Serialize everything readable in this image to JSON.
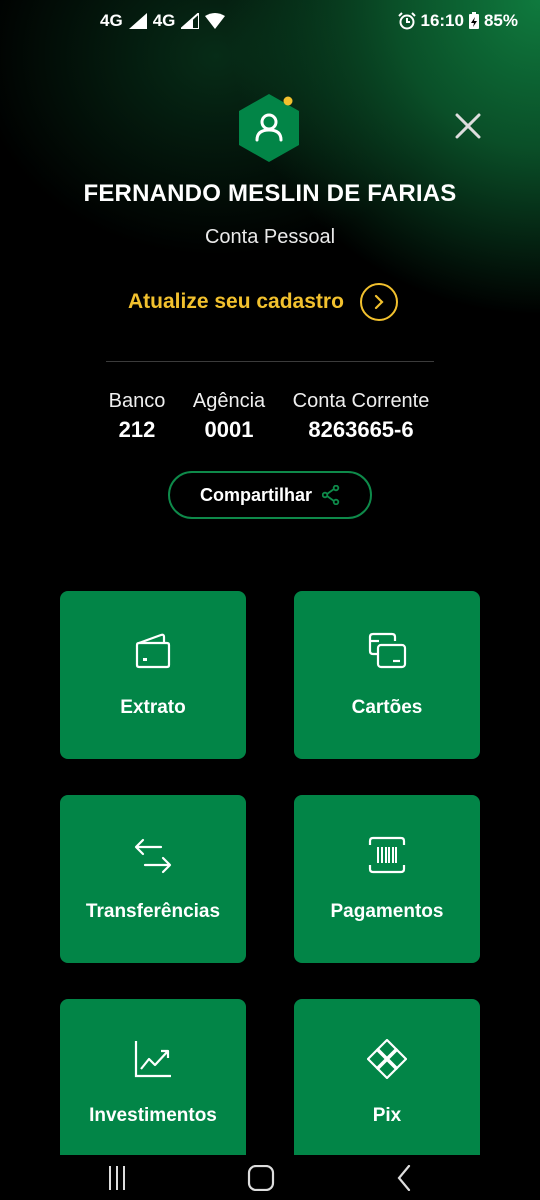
{
  "status_bar": {
    "network1": "4G",
    "network2": "4G",
    "time": "16:10",
    "battery": "85%"
  },
  "profile": {
    "name": "FERNANDO MESLIN DE FARIAS",
    "account_type": "Conta Pessoal",
    "update_label": "Atualize seu cadastro"
  },
  "account": {
    "bank_label": "Banco",
    "bank_value": "212",
    "agency_label": "Agência",
    "agency_value": "0001",
    "account_label": "Conta Corrente",
    "account_value": "8263665-6"
  },
  "share_label": "Compartilhar",
  "tiles": [
    {
      "label": "Extrato",
      "icon": "wallet-icon"
    },
    {
      "label": "Cartões",
      "icon": "cards-icon"
    },
    {
      "label": "Transferências",
      "icon": "transfer-arrows-icon"
    },
    {
      "label": "Pagamentos",
      "icon": "barcode-icon"
    },
    {
      "label": "Investimentos",
      "icon": "chart-icon"
    },
    {
      "label": "Pix",
      "icon": "pix-icon"
    }
  ],
  "colors": {
    "tile_green": "#028547",
    "accent_yellow": "#f2c12e",
    "border_green": "#0e8a4a"
  }
}
